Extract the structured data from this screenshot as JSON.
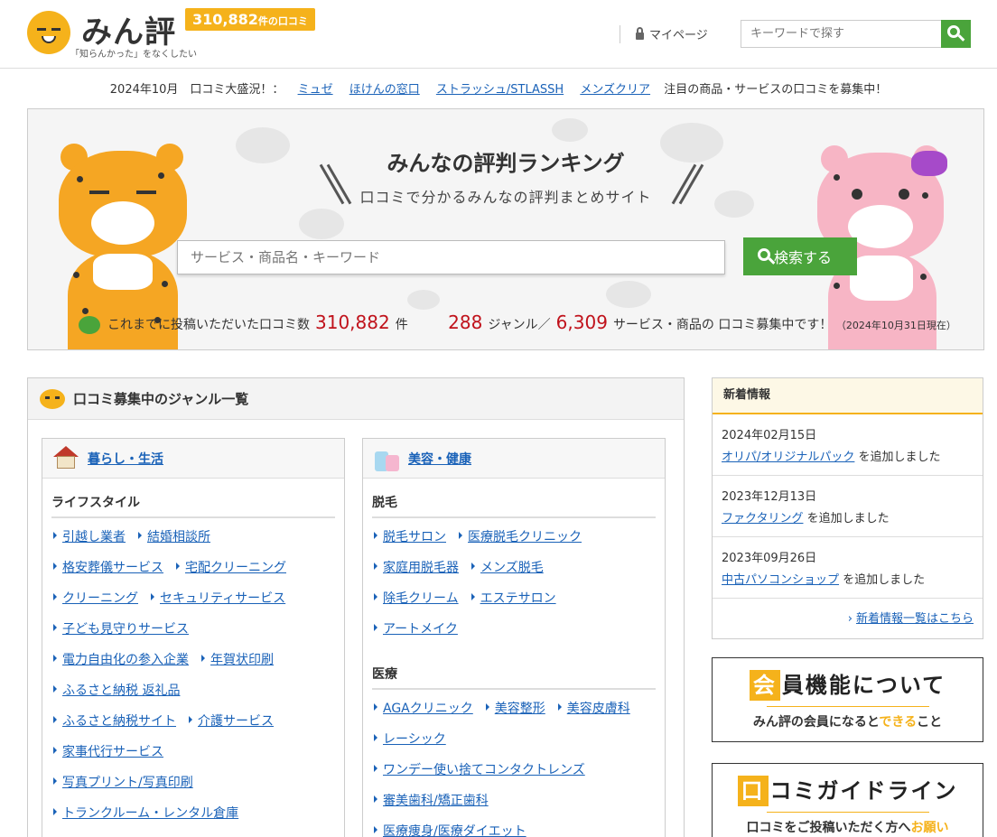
{
  "header": {
    "logo_text": "みん評",
    "logo_tagline": "「知らんかった」をなくしたい",
    "count_num": "310,882",
    "count_suffix": "件の口コミ",
    "mypage_label": "マイページ",
    "search_placeholder": "キーワードで探す"
  },
  "campaign": {
    "prefix": "2024年10月　口コミ大盛況！：",
    "links": [
      "ミュゼ",
      "ほけんの窓口",
      "ストラッシュ/STLASSH",
      "メンズクリア"
    ],
    "suffix": "注目の商品・サービスの口コミを募集中！"
  },
  "hero": {
    "title": "みんなの評判ランキング",
    "subtitle": "口コミで分かるみんなの評判まとめサイト",
    "search_placeholder": "サービス・商品名・キーワード",
    "search_button": "検索する",
    "stats_pre": "これまでに投稿いただいた口コミ数",
    "stats_reviews": "310,882",
    "stats_ken": "件",
    "stats_genres": "288",
    "stats_genre_label": "ジャンル／",
    "stats_services": "6,309",
    "stats_services_label": "サービス・商品の 口コミ募集中です！",
    "stats_date": "（2024年10月31日現在）"
  },
  "genres": {
    "heading": "口コミ募集中のジャンル一覧",
    "left": {
      "title": "暮らし・生活",
      "subheading": "ライフスタイル",
      "rows": [
        [
          "引越し業者",
          "結婚相談所"
        ],
        [
          "格安葬儀サービス",
          "宅配クリーニング"
        ],
        [
          "クリーニング",
          "セキュリティサービス"
        ],
        [
          "子ども見守りサービス"
        ],
        [
          "電力自由化の参入企業",
          "年賀状印刷"
        ],
        [
          "ふるさと納税 返礼品"
        ],
        [
          "ふるさと納税サイト",
          "介護サービス"
        ],
        [
          "家事代行サービス"
        ],
        [
          "写真プリント/写真印刷"
        ],
        [
          "トランクルーム・レンタル倉庫"
        ]
      ]
    },
    "right": {
      "title": "美容・健康",
      "sub1": "脱毛",
      "rows1": [
        [
          "脱毛サロン",
          "医療脱毛クリニック"
        ],
        [
          "家庭用脱毛器",
          "メンズ脱毛"
        ],
        [
          "除毛クリーム",
          "エステサロン"
        ],
        [
          "アートメイク"
        ]
      ],
      "sub2": "医療",
      "rows2": [
        [
          "AGAクリニック",
          "美容整形",
          "美容皮膚科"
        ],
        [
          "レーシック"
        ],
        [
          "ワンデー使い捨てコンタクトレンズ"
        ],
        [
          "審美歯科/矯正歯科"
        ],
        [
          "医療痩身/医療ダイエット"
        ]
      ]
    }
  },
  "news": {
    "heading": "新着情報",
    "items": [
      {
        "date": "2024年02月15日",
        "link": "オリパ/オリジナルパック",
        "text": "を追加しました"
      },
      {
        "date": "2023年12月13日",
        "link": "ファクタリング",
        "text": "を追加しました"
      },
      {
        "date": "2023年09月26日",
        "link": "中古パソコンショップ",
        "text": "を追加しました"
      }
    ],
    "more": "新着情報一覧はこちら"
  },
  "promo1": {
    "box": "会",
    "title": "員機能について",
    "sub_pre": "みん評の会員になると",
    "sub_hl": "できる",
    "sub_post": "こと"
  },
  "promo2": {
    "box": "口",
    "title": "コミガイドライン",
    "sub_pre": "口コミをご投稿いただく方へ",
    "sub_hl": "お願い"
  },
  "colors": {
    "brand": "#f5b21b",
    "search_green": "#4aa43b",
    "link": "#1a62b8",
    "accent_red": "#c0121b"
  }
}
